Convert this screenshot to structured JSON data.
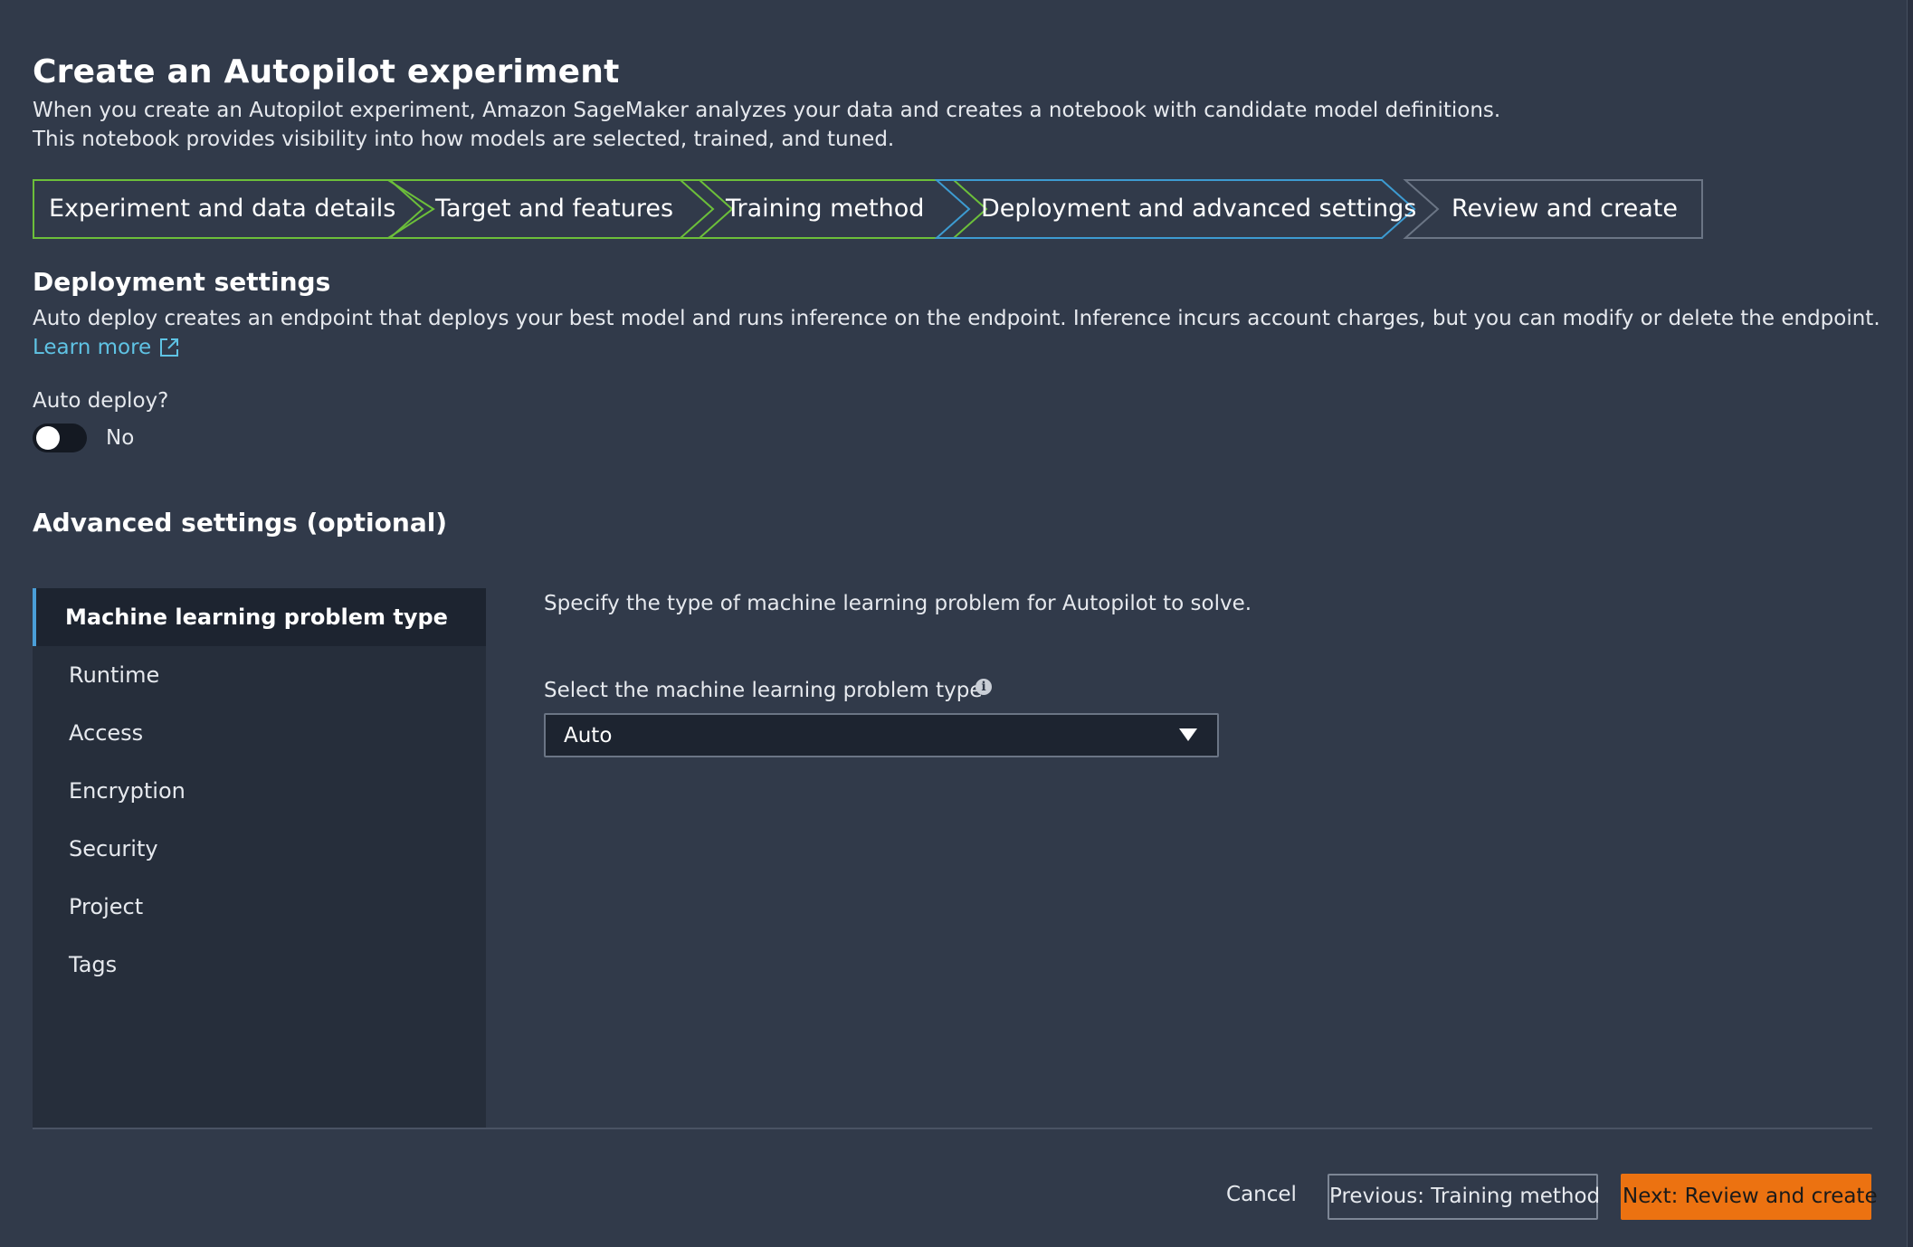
{
  "header": {
    "title": "Create an Autopilot experiment",
    "description_line1": "When you create an Autopilot experiment, Amazon SageMaker analyzes your data and creates a notebook with candidate model definitions.",
    "description_line2": "This notebook provides visibility into how models are selected, trained, and tuned."
  },
  "stepper": {
    "steps": [
      {
        "label": "Experiment and data details",
        "state": "completed"
      },
      {
        "label": "Target and features",
        "state": "completed"
      },
      {
        "label": "Training method",
        "state": "completed"
      },
      {
        "label": "Deployment and advanced settings",
        "state": "current"
      },
      {
        "label": "Review and create",
        "state": "upcoming"
      }
    ]
  },
  "deployment": {
    "title": "Deployment settings",
    "description": "Auto deploy creates an endpoint that deploys your best model and runs inference on the endpoint. Inference incurs account charges, but you can modify or delete the endpoint.",
    "learn_more": "Learn more",
    "auto_deploy_label": "Auto deploy?",
    "auto_deploy_value": "No",
    "auto_deploy_on": false
  },
  "advanced": {
    "title": "Advanced settings (optional)",
    "nav_items": [
      {
        "label": "Machine learning problem type",
        "active": true
      },
      {
        "label": "Runtime",
        "active": false
      },
      {
        "label": "Access",
        "active": false
      },
      {
        "label": "Encryption",
        "active": false
      },
      {
        "label": "Security",
        "active": false
      },
      {
        "label": "Project",
        "active": false
      },
      {
        "label": "Tags",
        "active": false
      }
    ],
    "panel_description": "Specify the type of machine learning problem for Autopilot to solve.",
    "select_label": "Select the machine learning problem type",
    "select_value": "Auto"
  },
  "footer": {
    "cancel": "Cancel",
    "previous": "Previous: Training method",
    "next": "Next: Review and create"
  },
  "colors": {
    "background": "#313a4a",
    "completed_step": "#6cbf3a",
    "current_step": "#3d9bd1",
    "upcoming_step": "#6b7585",
    "link": "#5fc3e4",
    "primary_button": "#ec7211"
  }
}
